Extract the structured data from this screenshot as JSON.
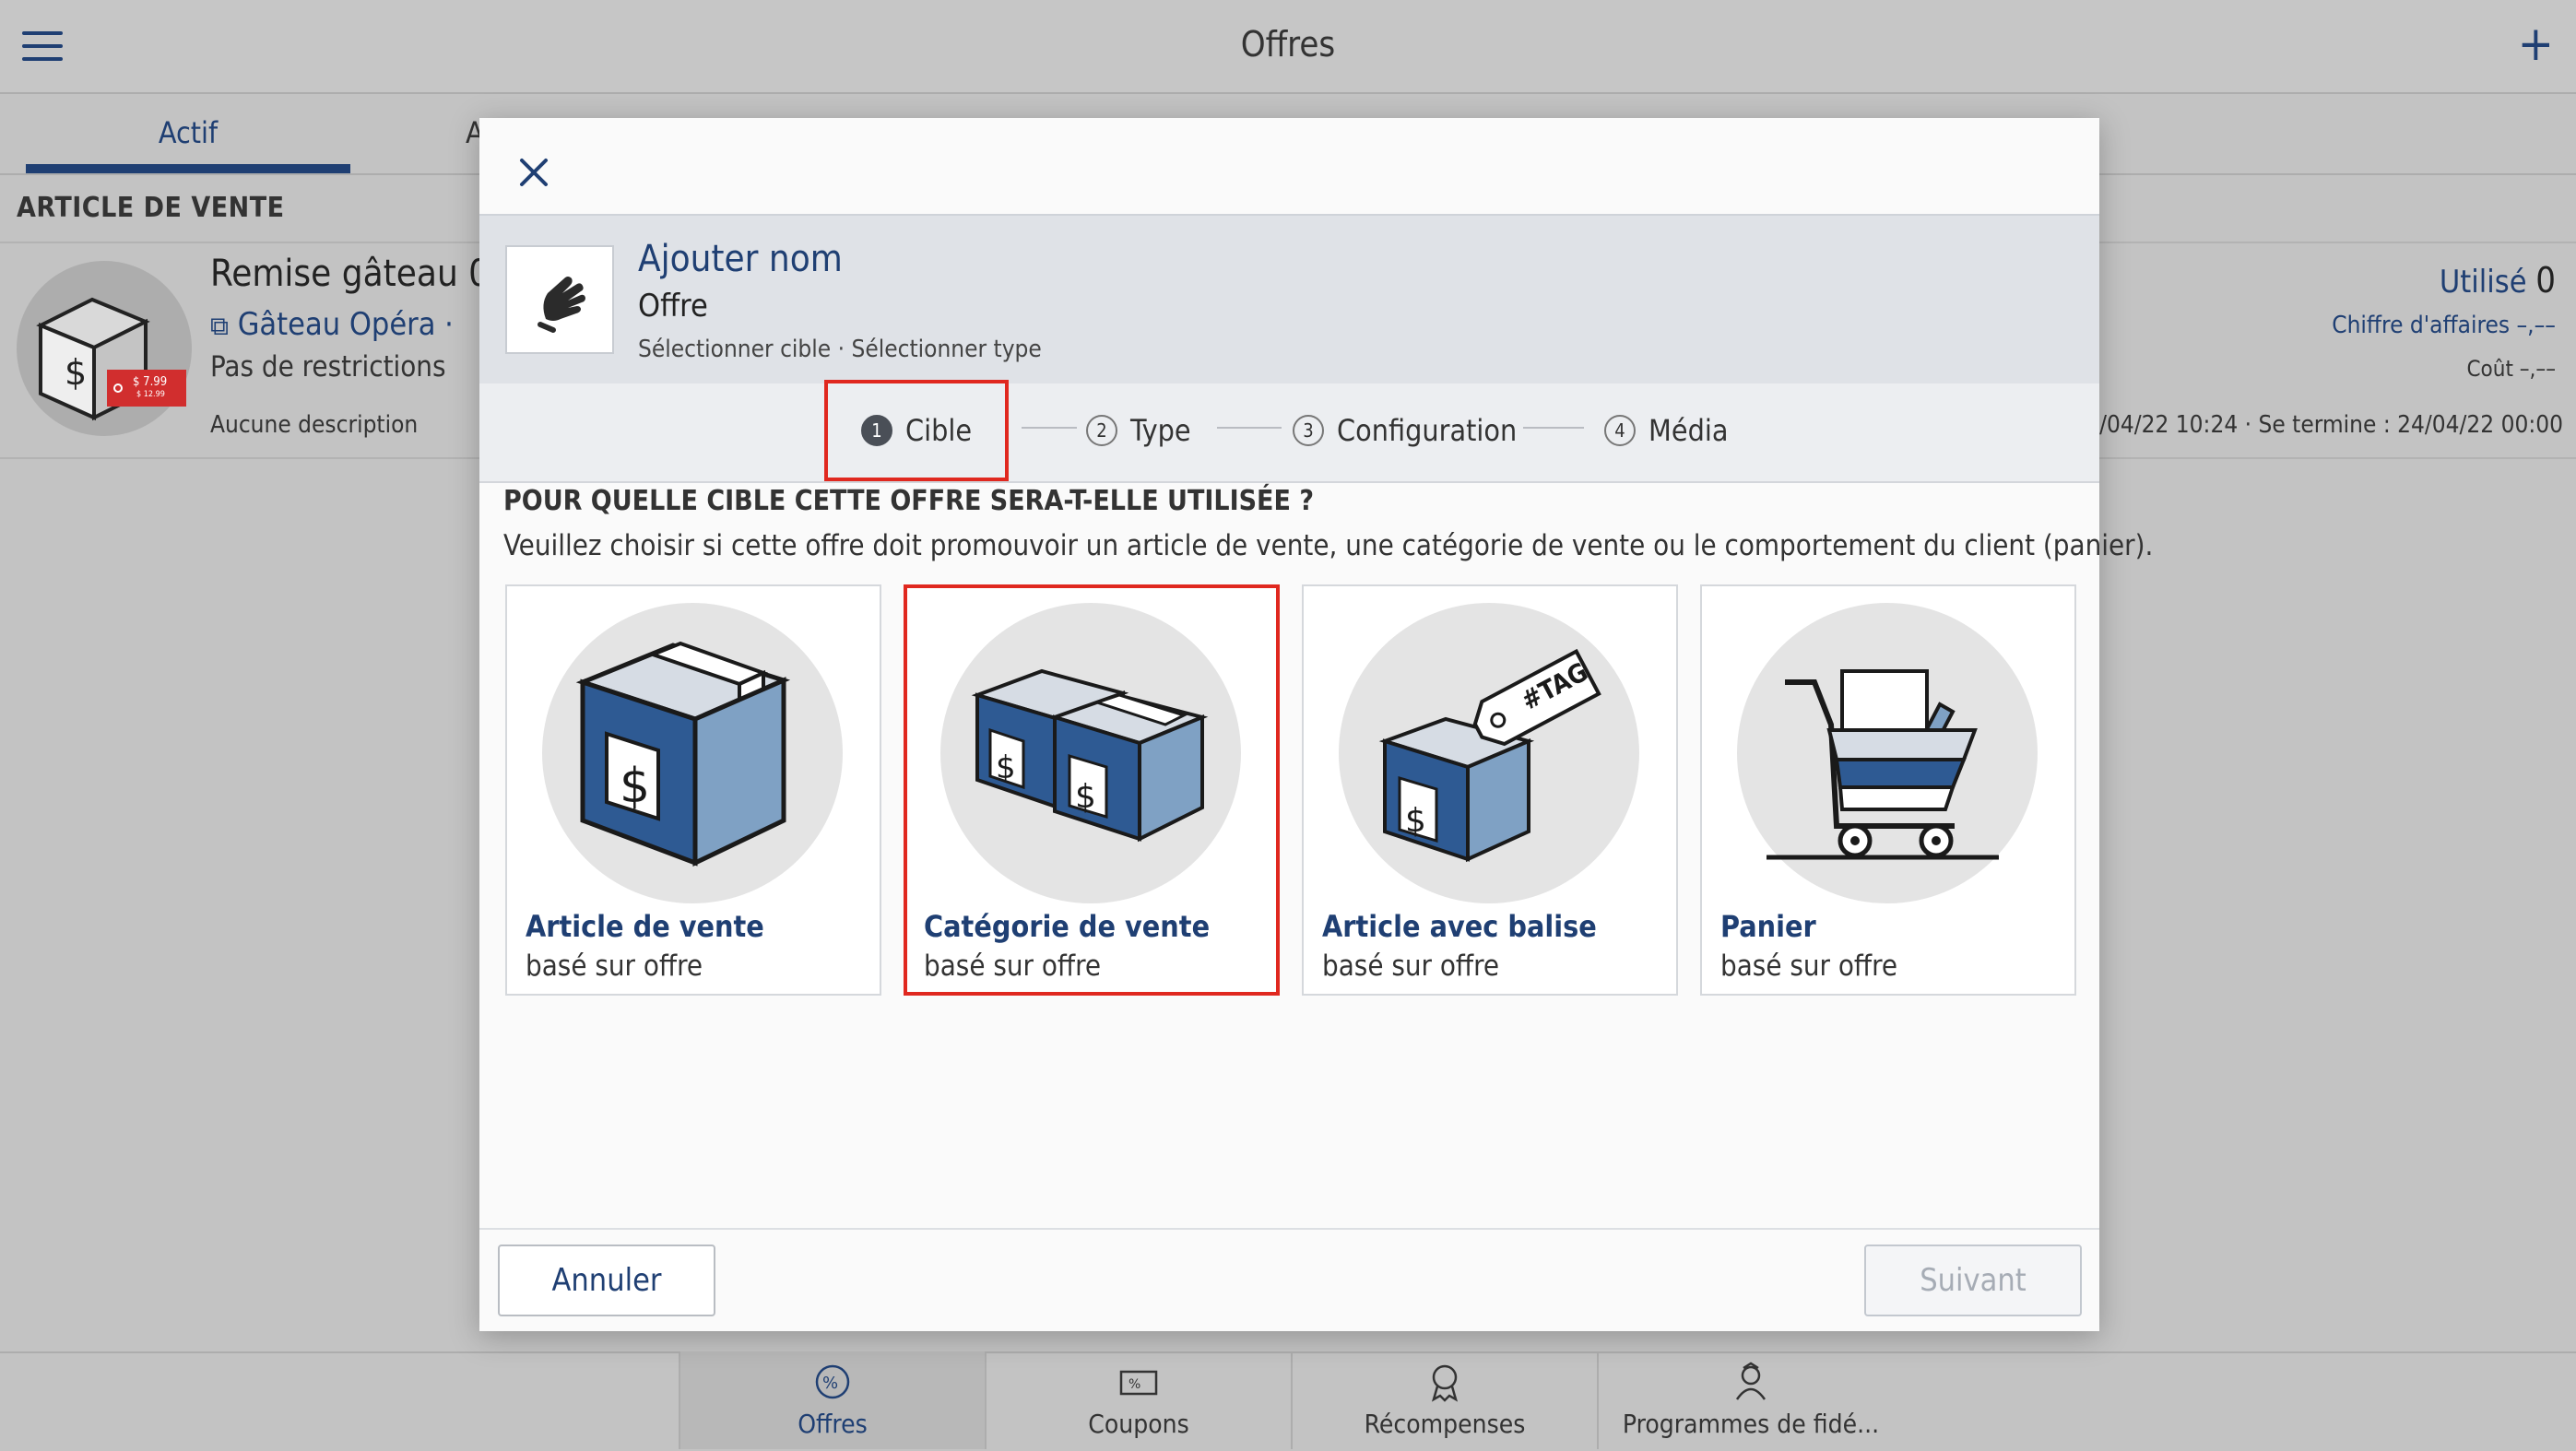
{
  "app": {
    "title": "Offres",
    "tabs": [
      {
        "label": "Actif"
      },
      {
        "label": "A"
      }
    ],
    "section_header": "ARTICLE DE VENTE",
    "row": {
      "title": "Remise gâteau 0",
      "subtitle": "Gâteau Opéra ·",
      "restrictions": "Pas de restrictions",
      "description": "Aucune description",
      "price_tag_new": "$ 7.99",
      "price_tag_old": "$ 12.99",
      "used_label": "Utilisé",
      "used_value": "0",
      "revenue": "Chiffre d'affaires –,––",
      "cost": "Coût –,––",
      "dates": "/04/22 10:24 · Se termine : 24/04/22 00:00"
    },
    "bottom_nav": [
      {
        "label": "Offres",
        "icon": "offer-percent-icon"
      },
      {
        "label": "Coupons",
        "icon": "coupon-icon"
      },
      {
        "label": "Récompenses",
        "icon": "award-icon"
      },
      {
        "label": "Programmes de fidé...",
        "icon": "loyalty-icon"
      }
    ]
  },
  "modal": {
    "header": {
      "name": "Ajouter nom",
      "type": "Offre",
      "crumbs": "Sélectionner cible · Sélectionner type"
    },
    "steps": [
      {
        "num": "1",
        "label": "Cible"
      },
      {
        "num": "2",
        "label": "Type"
      },
      {
        "num": "3",
        "label": "Configuration"
      },
      {
        "num": "4",
        "label": "Média"
      }
    ],
    "question_title": "POUR QUELLE CIBLE CETTE OFFRE SERA-T-ELLE UTILISÉE ?",
    "question_desc": "Veuillez choisir si cette offre doit promouvoir un article de vente, une catégorie de vente ou le comportement du client (panier).",
    "cards": [
      {
        "title": "Article de vente",
        "sub": "basé sur offre"
      },
      {
        "title": "Catégorie de vente",
        "sub": "basé sur offre"
      },
      {
        "title": "Article avec balise",
        "sub": "basé sur offre",
        "tag": "#TAG"
      },
      {
        "title": "Panier",
        "sub": "basé sur offre"
      }
    ],
    "cancel_label": "Annuler",
    "next_label": "Suivant"
  },
  "colors": {
    "brand_navy": "#1f3f73",
    "box_blue": "#2e5a93",
    "box_light": "#7fa1c4",
    "highlight_red": "#e0281f"
  }
}
